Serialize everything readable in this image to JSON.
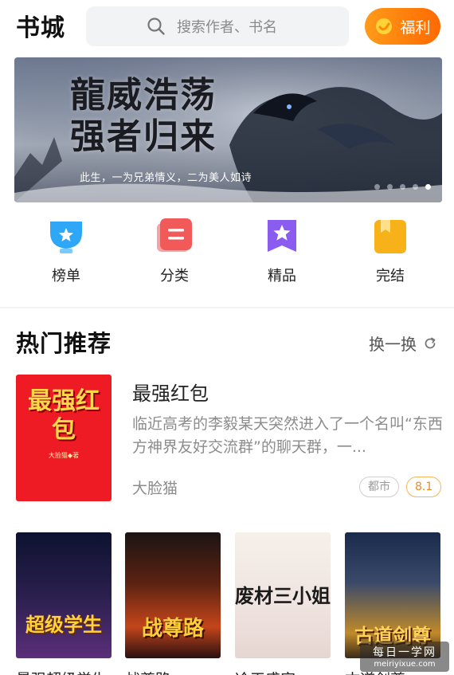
{
  "header": {
    "title": "书城",
    "search_placeholder": "搜索作者、书名",
    "welfare_label": "福利"
  },
  "banner": {
    "title_line1": "龍威浩荡",
    "title_line2": "强者归来",
    "subtitle": "此生，一为兄弟情义，二为美人如诗",
    "dots": 5,
    "active_dot": 4
  },
  "categories": [
    {
      "label": "榜单",
      "icon": "trophy-icon",
      "color": "#2ea7f7"
    },
    {
      "label": "分类",
      "icon": "category-icon",
      "color": "#f25a5a"
    },
    {
      "label": "精品",
      "icon": "star-bookmark-icon",
      "color": "#8a5cf0"
    },
    {
      "label": "完结",
      "icon": "finished-book-icon",
      "color": "#f7b219"
    }
  ],
  "hot": {
    "title": "热门推荐",
    "refresh_label": "换一换",
    "featured": {
      "title": "最强红包",
      "description": "临近高考的李毅某天突然进入了一个名叫“东西方神界友好交流群”的聊天群，一...",
      "author": "大脸猫",
      "genre": "都市",
      "score": "8.1",
      "cover_text": "最强红包",
      "cover_author": "大脸猫◆著"
    },
    "grid": [
      {
        "title": "最强超级学生",
        "cover_text": "超级学生"
      },
      {
        "title": "战尊路",
        "cover_text": "战尊路"
      },
      {
        "title": "冷王盛宠",
        "cover_text": "废材三小姐"
      },
      {
        "title": "古道剑尊",
        "cover_text": "古道剑尊"
      }
    ]
  },
  "watermark": {
    "line1": "每日一学网",
    "line2": "meiriyixue.com"
  },
  "colors": {
    "accent": "#ff7a00",
    "score_tag": "#f08a1c"
  }
}
